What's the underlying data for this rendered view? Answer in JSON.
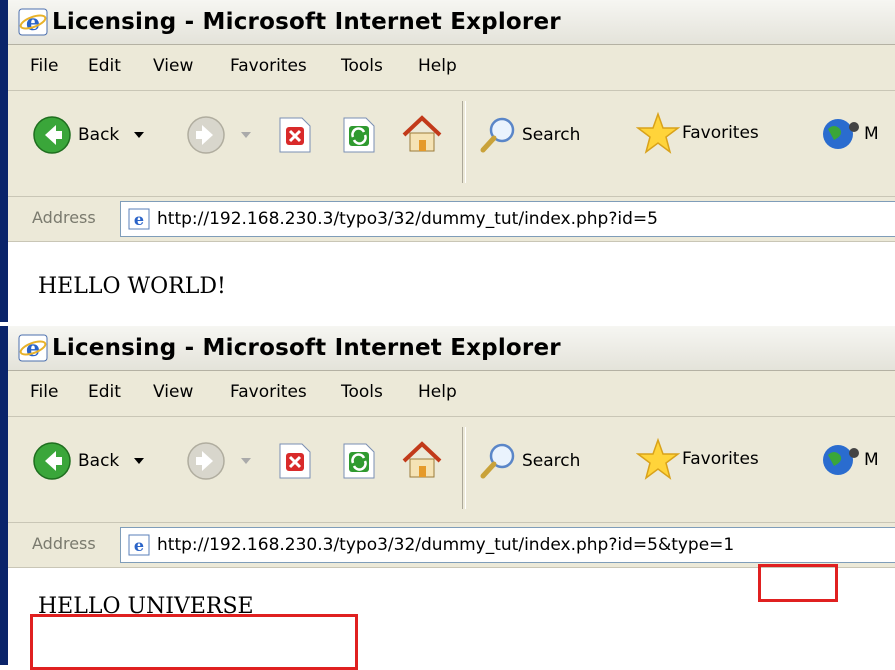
{
  "windows": [
    {
      "title": "Licensing - Microsoft Internet Explorer",
      "menu": [
        "File",
        "Edit",
        "View",
        "Favorites",
        "Tools",
        "Help"
      ],
      "toolbar": {
        "back": "Back",
        "search": "Search",
        "favorites": "Favorites",
        "media_cut": "M"
      },
      "address": {
        "label": "Address",
        "url": "http://192.168.230.3/typo3/32/dummy_tut/index.php?id=5"
      },
      "content": "HELLO WORLD!"
    },
    {
      "title": "Licensing - Microsoft Internet Explorer",
      "menu": [
        "File",
        "Edit",
        "View",
        "Favorites",
        "Tools",
        "Help"
      ],
      "toolbar": {
        "back": "Back",
        "search": "Search",
        "favorites": "Favorites",
        "media_cut": "M"
      },
      "address": {
        "label": "Address",
        "url": "http://192.168.230.3/typo3/32/dummy_tut/index.php?id=5&type=1"
      },
      "content": "HELLO UNIVERSE"
    }
  ],
  "colors": {
    "highlight": "#e02020",
    "chrome": "#ece9d8",
    "titlebar_edge": "#0a246a"
  },
  "icons": [
    "ie-logo-icon",
    "back-arrow-icon",
    "dropdown-arrow-icon",
    "forward-arrow-icon",
    "stop-icon",
    "refresh-icon",
    "home-icon",
    "search-magnifier-icon",
    "favorites-star-icon",
    "media-globe-icon",
    "page-icon"
  ]
}
